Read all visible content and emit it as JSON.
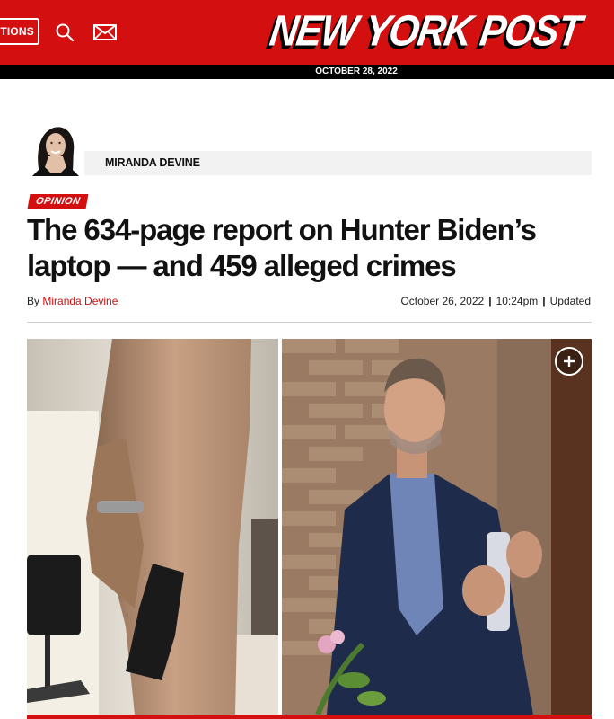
{
  "header": {
    "editions_label": "TIONS",
    "logo_text": "NEW YORK POST",
    "date": "OCTOBER 28, 2022",
    "brand_red": "#d30f0f"
  },
  "author": {
    "name": "MIRANDA DEVINE"
  },
  "article": {
    "category": "OPINION",
    "headline": "The 634-page report on Hunter Biden’s laptop — and 459 alleged crimes",
    "byline_prefix": "By",
    "byline_author": "Miranda Devine",
    "published": "October 26, 2022",
    "time": "10:24pm",
    "updated_label": "Updated"
  },
  "icons": {
    "search": "search-icon",
    "mail": "mail-icon",
    "expand": "plus-circle-icon"
  }
}
